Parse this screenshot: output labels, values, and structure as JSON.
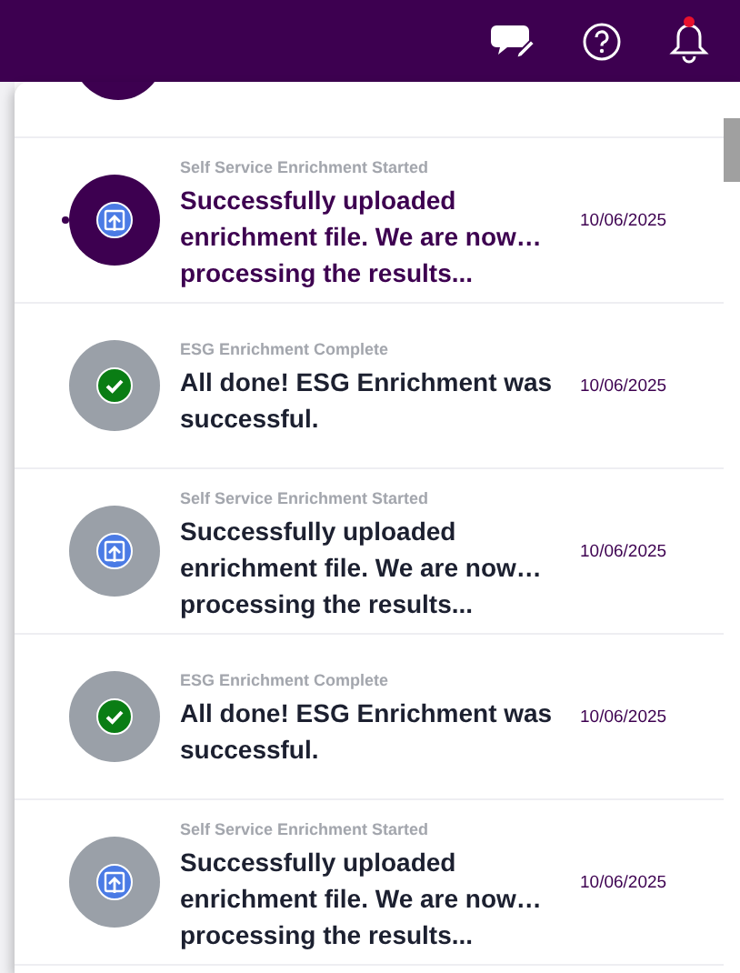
{
  "header": {
    "icons": [
      {
        "kind": "chat"
      },
      {
        "kind": "help"
      },
      {
        "kind": "bell",
        "alert": true
      }
    ]
  },
  "notifications": [
    {
      "kind": "upload",
      "unread": true,
      "category": "Self Service Enrichment Started",
      "message": "Successfully uploaded enrichment file. We are now… processing the results...",
      "date": "10/06/2025"
    },
    {
      "kind": "complete",
      "unread": false,
      "category": "ESG Enrichment Complete",
      "message": "All done! ESG Enrichment was successful.",
      "date": "10/06/2025"
    },
    {
      "kind": "upload",
      "unread": false,
      "category": "Self Service Enrichment Started",
      "message": "Successfully uploaded enrichment file. We are now… processing the results...",
      "date": "10/06/2025"
    },
    {
      "kind": "complete",
      "unread": false,
      "category": "ESG Enrichment Complete",
      "message": "All done! ESG Enrichment was successful.",
      "date": "10/06/2025"
    },
    {
      "kind": "upload",
      "unread": false,
      "category": "Self Service Enrichment Started",
      "message": "Successfully uploaded enrichment file. We are now… processing the results...",
      "date": "10/06/2025"
    }
  ]
}
